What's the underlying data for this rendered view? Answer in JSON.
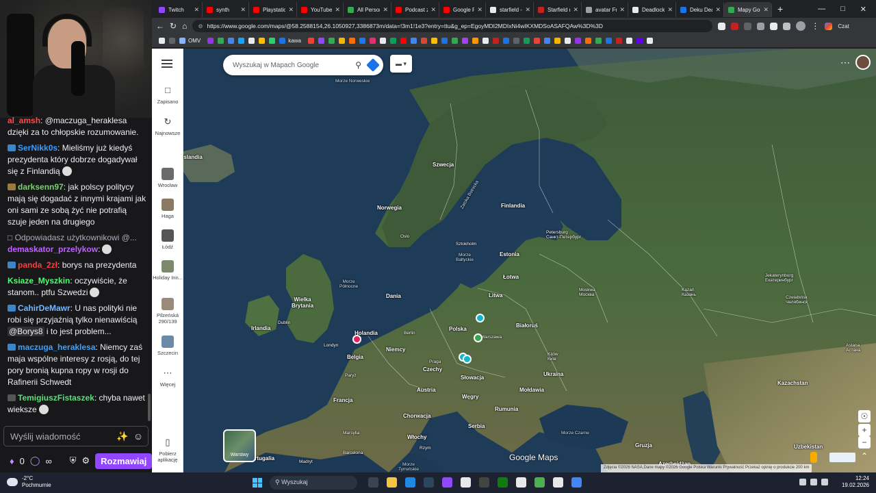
{
  "chat": {
    "messages": [
      {
        "user": "al_amsh",
        "text": ": @maczuga_heraklesa dzięki za to chłopskie rozumowanie.",
        "color": "#ff4a4a"
      },
      {
        "user": "SerNikk0s",
        "text": ": Mieliśmy już kiedyś prezydenta który dobrze dogadywał się z Finlandią",
        "color": "#3b9cff"
      },
      {
        "user": "darksenn97",
        "text": ": jak polscy politycy mają się dogadać z innymi krajami jak oni sami ze sobą żyć nie potrafią szuje jeden na drugiego",
        "color": "#7ad36a"
      },
      {
        "reply": "Odpowiadasz użytkownikowi @...",
        "user": "demaskator_przelykow",
        "text": ":",
        "color": "#c062ff"
      },
      {
        "user": "panda_2zł",
        "text": ": borys na prezydenta",
        "color": "#ff3b3b"
      },
      {
        "user": "Ksiaze_Myszkin",
        "text": ": oczywiście, że stanom.. ptfu Szwedzi",
        "color": "#4cff70"
      },
      {
        "user": "CahirDeMawr",
        "text": ": U nas polityki nie robi się przyjaźnią tylko nienawiścią",
        "mention": "@Borys8",
        "text2": " i to jest problem...",
        "color": "#76b7ff"
      },
      {
        "user": "maczuga_heraklesa",
        "text": ": Niemcy zaś maja wspólne interesy z rosją, do tej pory bronią kupna ropy w rosji do Rafinerii Schwedt",
        "color": "#3aa3ff"
      },
      {
        "user": "TemigiuszFistaszek",
        "text": ": chyba nawet wieksze",
        "color": "#5ce07d"
      }
    ],
    "input_placeholder": "Wyślij wiadomość",
    "points": "0",
    "send_label": "Rozmawiaj"
  },
  "browser": {
    "tabs": [
      {
        "label": "Twitch",
        "color": "#9147ff"
      },
      {
        "label": "synth",
        "color": "#ff0000"
      },
      {
        "label": "Playstation",
        "color": "#ff0000"
      },
      {
        "label": "YouTube",
        "color": "#ff0000"
      },
      {
        "label": "All Personal",
        "color": "#34a853"
      },
      {
        "label": "Podcast z",
        "color": "#ff0000"
      },
      {
        "label": "Google Pl",
        "color": "#ff0000"
      },
      {
        "label": "starfield -",
        "color": "#e8eaed"
      },
      {
        "label": "Starfield n",
        "color": "#c5221f"
      },
      {
        "label": "avatar Fro",
        "color": "#9aa0a6"
      },
      {
        "label": "Deadlock",
        "color": "#e8eaed"
      },
      {
        "label": "Deku Deal",
        "color": "#1a73e8"
      },
      {
        "label": "Mapy Goo",
        "color": "#34a853",
        "active": true
      }
    ],
    "url": "https://www.google.com/maps/@58.2588154,26.1050927,3386873m/data=!3m1!1e3?entry=ttu&g_ep=EgoyMDI2MDIxNi4wIKXMDSoASAFQAw%3D%3D",
    "bookmark_label": "OMV",
    "bookmark_label2": "kawa",
    "profile_label": "Czat"
  },
  "maps": {
    "search_placeholder": "Wyszukaj w Mapach Google",
    "rail": [
      {
        "label": "Zapisano",
        "icon": "bookmark-icon"
      },
      {
        "label": "Najnowsze",
        "icon": "history-icon"
      },
      {
        "label": "Wrocław"
      },
      {
        "label": "Haga"
      },
      {
        "label": "Łódź"
      },
      {
        "label": "Holiday Inn..."
      },
      {
        "label": "Pilzeńská 290/139"
      },
      {
        "label": "Szczecin"
      },
      {
        "label": "Więcej"
      },
      {
        "label": "Pobierz aplikację"
      }
    ],
    "layers_label": "Warstwy",
    "logo": "Google Maps",
    "attribution": "Zdjęcia ©2026 NASA,Dane mapy ©2026 Google   Polska   Warunki   Prywatność   Przekaż opinię o produkcie   200 km",
    "labels": {
      "szwecja": "Szwecja",
      "finlandia": "Finlandia",
      "norwegia": "Norwegia",
      "islandia": "Islandia",
      "oslo": "Oslo",
      "sztokholm": "Sztokholm",
      "petersburg": "Petersburg\nСанкт-Петербург",
      "estonia": "Estonia",
      "lotwa": "Łotwa",
      "litwa": "Litwa",
      "dania": "Dania",
      "wielka_brytania": "Wielka\nBrytania",
      "irlandia": "Irlandia",
      "dublin": "Dublin",
      "holandia": "Holandia",
      "londyn": "Londyn",
      "belgia": "Belgia",
      "berlin": "Berlin",
      "niemcy": "Niemcy",
      "polska": "Polska",
      "warszawa": "Warszawa",
      "bialorus": "Białoruś",
      "moskwa": "Moskwa\nМосква",
      "kazan": "Kazań\nКазань",
      "jekaterynburg": "Jekaterynburg\nЕкатеринбург",
      "czelabinsk": "Czelabińsk\nЧелябинск",
      "astana": "Astana\nАстана",
      "praga": "Praga",
      "czechy": "Czechy",
      "slowacja": "Słowacja",
      "kijow": "Kijów\nКиїв",
      "ukraina": "Ukraina",
      "paryz": "Paryż",
      "francja": "Francja",
      "austria": "Austria",
      "wegry": "Węgry",
      "moldawia": "Mołdawia",
      "rumunia": "Rumunia",
      "chorwacja": "Chorwacja",
      "serbia": "Serbia",
      "kazachstan": "Kazachstan",
      "wlochy": "Włochy",
      "marsylia": "Marsylia",
      "barcelona": "Barcelona",
      "madryt": "Madryt",
      "portugalia": "Portugalia",
      "rzym": "Rzym",
      "morze_czarne": "Morze Czarne",
      "gruzja": "Gruzja",
      "azerbejdzan": "Azerbejdżan",
      "uzbekistan": "Uzbekistan",
      "morze_norweskie": "Morze\nNorweskie",
      "morze_polnocne": "Morze\nPółnocne",
      "morze_baltyckie": "Morze\nBałtyckie",
      "zatoka_botnicka": "Zatoka Botnicka",
      "morze_tyrrenskie": "Morze\nTyrreńskie"
    }
  },
  "taskbar": {
    "temp": "-2°C",
    "weather": "Pochmurnie",
    "search": "Wyszukaj",
    "time": "12:24",
    "date": "19.02.2026"
  }
}
